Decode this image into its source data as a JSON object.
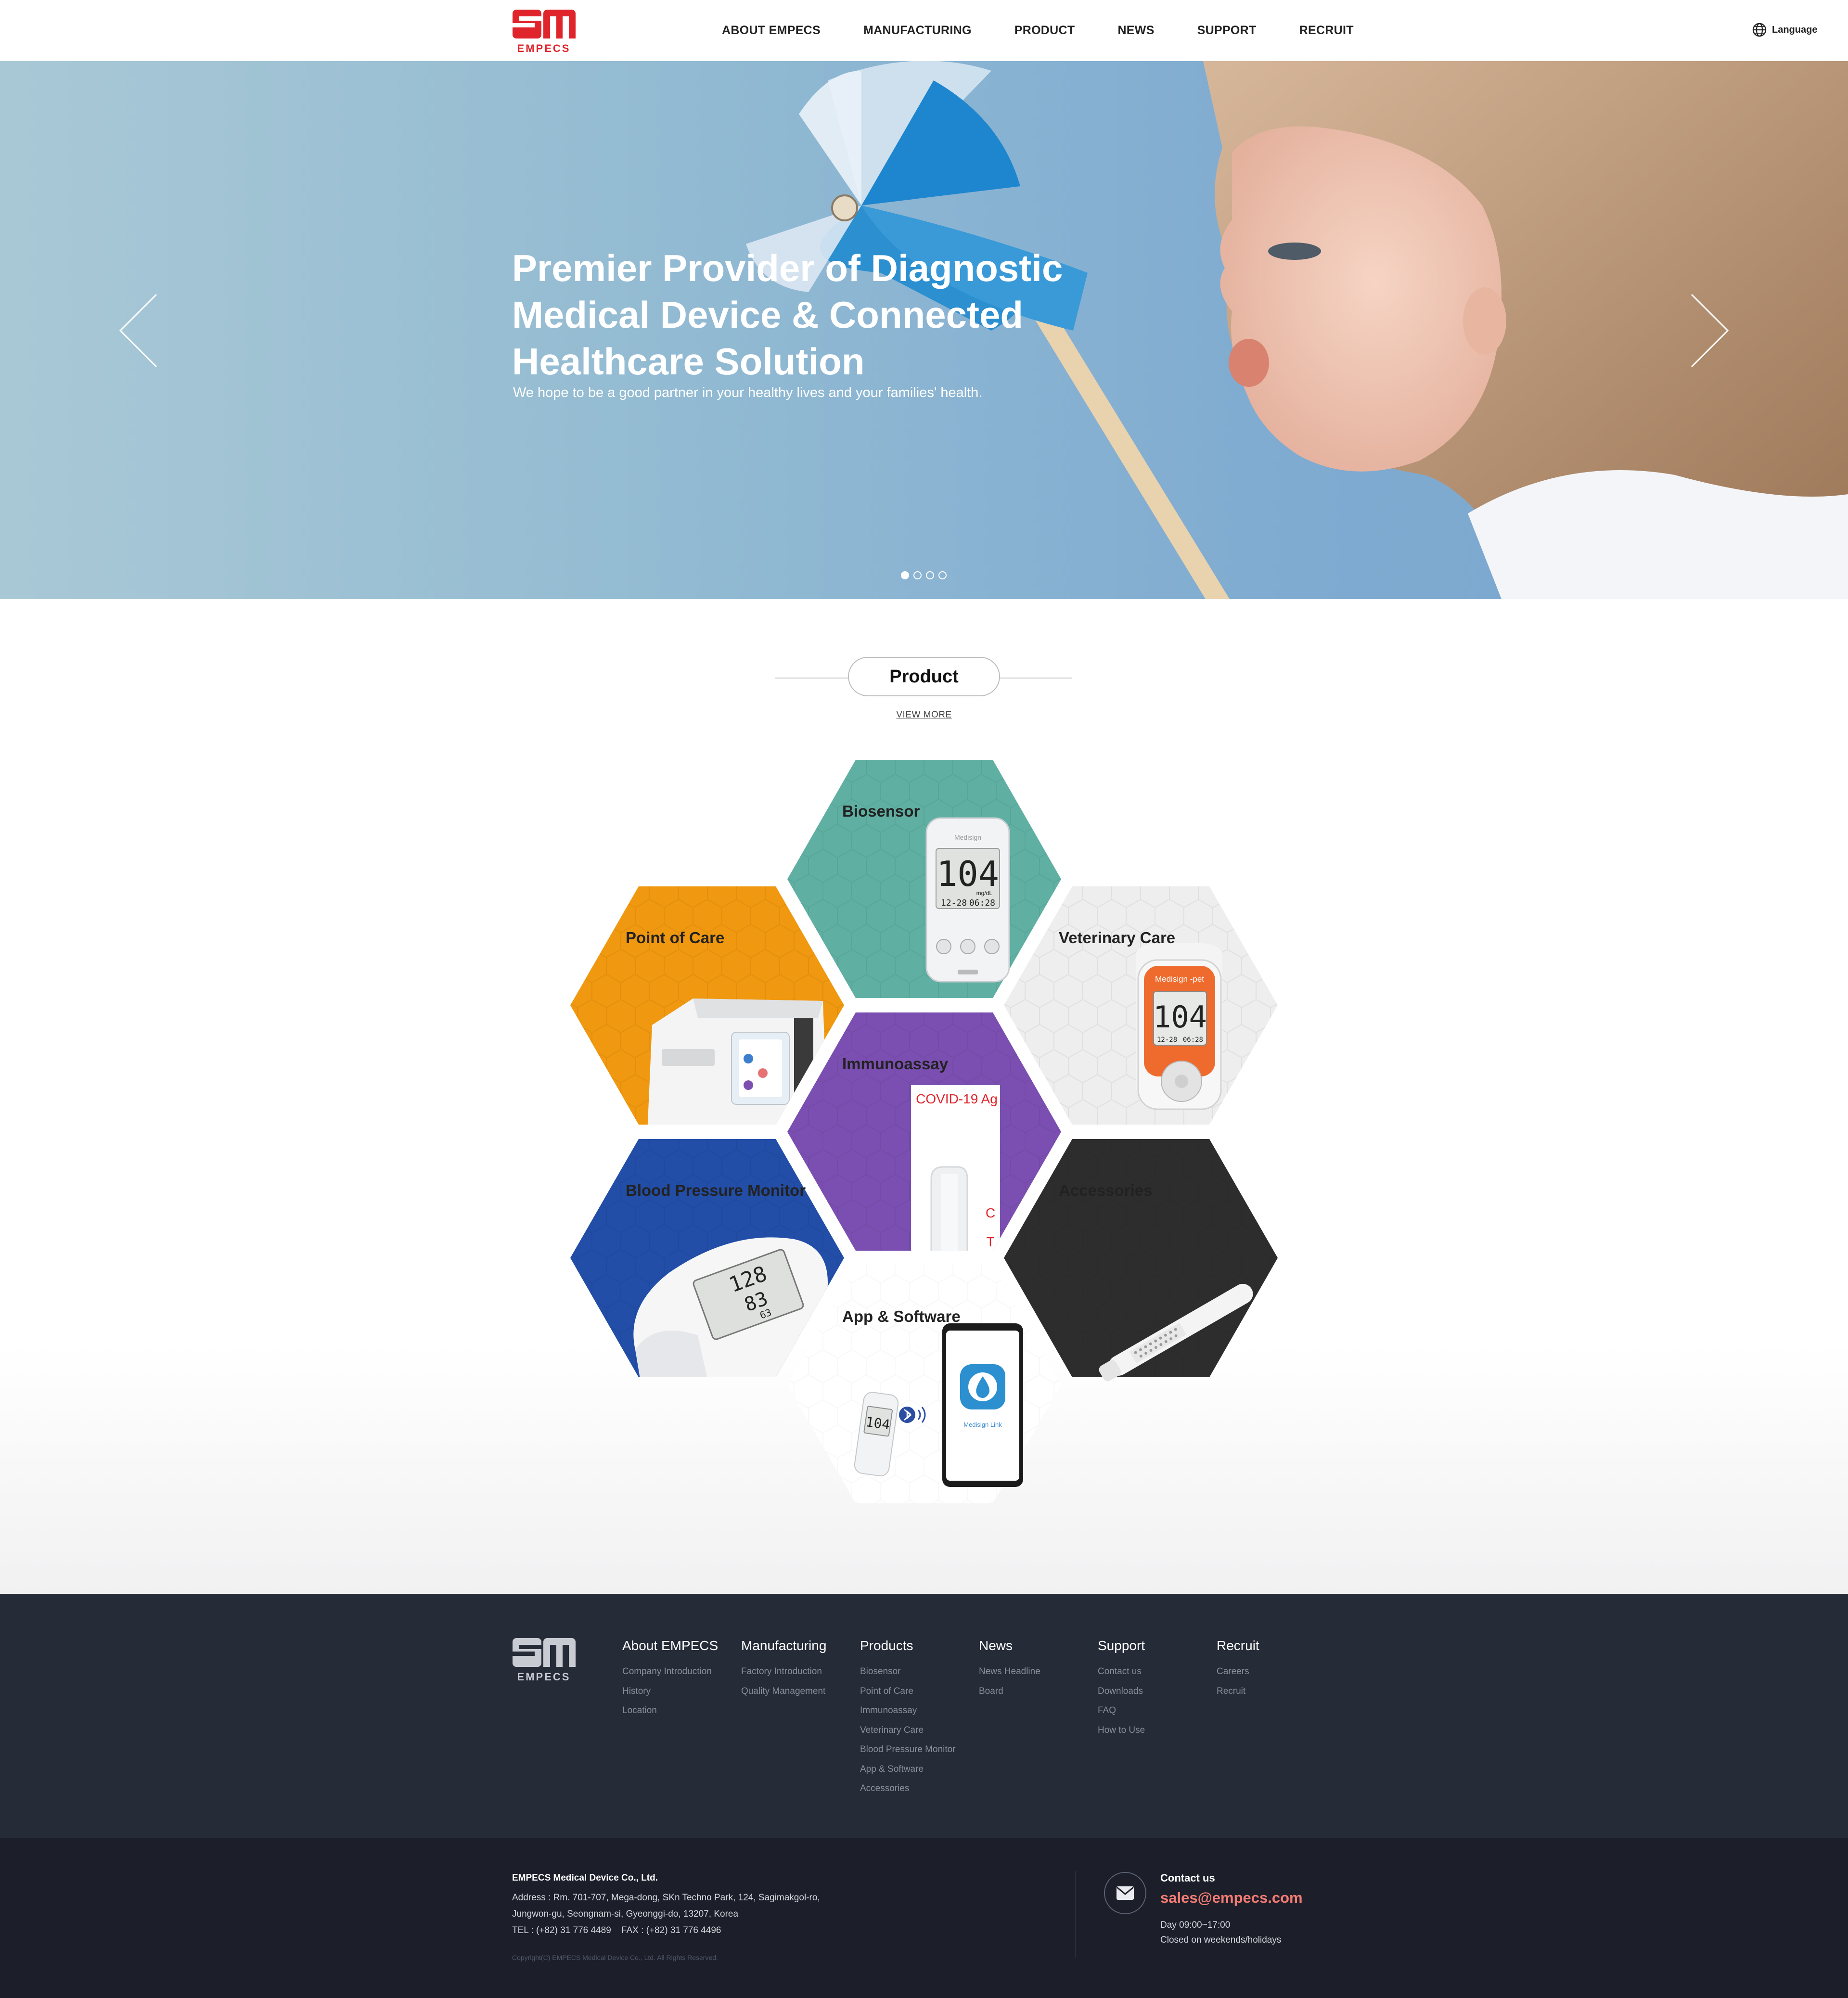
{
  "header": {
    "logo_text": "EMPECS",
    "nav": [
      "ABOUT EMPECS",
      "MANUFACTURING",
      "PRODUCT",
      "NEWS",
      "SUPPORT",
      "RECRUIT"
    ],
    "language_label": "Language"
  },
  "hero": {
    "title_lines": [
      "Premier Provider of Diagnostic",
      "Medical Device & Connected",
      "Healthcare Solution"
    ],
    "subtitle": "We hope to be a good partner in your healthy lives and your families' health.",
    "slide_count": 4,
    "active_slide": 1
  },
  "products": {
    "section_title": "Product",
    "view_more": "VIEW MORE",
    "items": [
      {
        "label": "Biosensor",
        "color": "#5fb0a3",
        "label_color": "#ffffff"
      },
      {
        "label": "Point of Care",
        "color": "#f0980f",
        "label_color": "#ffffff"
      },
      {
        "label": "Veterinary Care",
        "color": "#eeeeee",
        "label_color": "#222222"
      },
      {
        "label": "Immunoassay",
        "color": "#7b4fb1",
        "label_color": "#ffffff"
      },
      {
        "label": "Blood Pressure Monitor",
        "color": "#224ea8",
        "label_color": "#ffffff"
      },
      {
        "label": "Accessories",
        "color": "#2d2d2d",
        "label_color": "#ffffff"
      },
      {
        "label": "App & Software",
        "color": "#ffffff",
        "label_color": "#222222"
      }
    ],
    "device_texts": {
      "glucose_reading": "104",
      "glucose_unit": "mg/dL",
      "glucose_date": "12-28",
      "glucose_time": "06:28",
      "brand": "Medisign",
      "vet_brand": "Medisign -pet",
      "covid_label": "COVID-19 Ag",
      "covid_c": "C",
      "covid_t": "T",
      "app_name": "Medisign Link"
    }
  },
  "footer": {
    "columns": [
      {
        "title": "About EMPECS",
        "items": [
          "Company Introduction",
          "History",
          "Location"
        ]
      },
      {
        "title": "Manufacturing",
        "items": [
          "Factory Introduction",
          "Quality Management"
        ]
      },
      {
        "title": "Products",
        "items": [
          "Biosensor",
          "Point of Care",
          "Immunoassay",
          "Veterinary Care",
          "Blood Pressure Monitor",
          "App & Software",
          "Accessories"
        ]
      },
      {
        "title": "News",
        "items": [
          "News Headline",
          "Board"
        ]
      },
      {
        "title": "Support",
        "items": [
          "Contact us",
          "Downloads",
          "FAQ",
          "How to Use"
        ]
      },
      {
        "title": "Recruit",
        "items": [
          "Careers",
          "Recruit"
        ]
      }
    ],
    "company": "EMPECS Medical Device Co., Ltd.",
    "address_lines": [
      "Address : Rm. 701-707, Mega-dong, SKn Techno Park, 124, Sagimakgol-ro,",
      "Jungwon-gu, Seongnam-si, Gyeonggi-do, 13207, Korea",
      "TEL : (+82) 31 776 4489    FAX : (+82) 31 776 4496"
    ],
    "copyright": "Copyright(C) EMPECS Medical Device Co., Ltd. All Rights Reserved.",
    "contact_title": "Contact us",
    "contact_email": "sales@empecs.com",
    "hours_lines": [
      "Day 09:00~17:00",
      "Closed on weekends/holidays"
    ]
  },
  "colors": {
    "brand_red": "#e0242b",
    "footer_top": "#262b38",
    "footer_bottom": "#1c1f2a",
    "email_accent": "#f37b73"
  }
}
